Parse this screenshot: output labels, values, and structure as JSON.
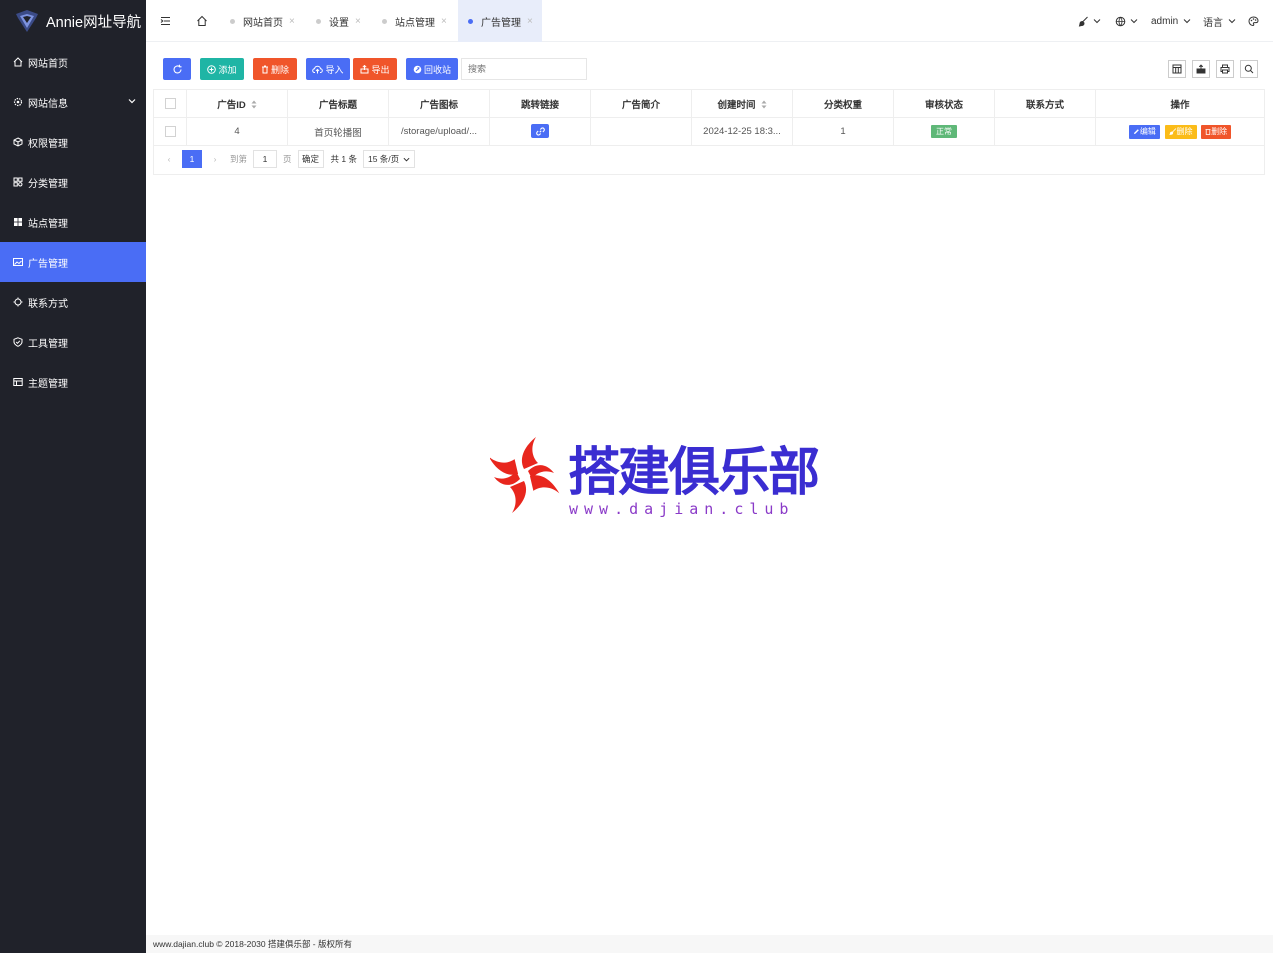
{
  "app": {
    "title": "Annie网址导航"
  },
  "sidebar": {
    "items": [
      {
        "label": "网站首页",
        "icon": "home-icon"
      },
      {
        "label": "网站信息",
        "icon": "gear-icon"
      },
      {
        "label": "权限管理",
        "icon": "cube-icon"
      },
      {
        "label": "分类管理",
        "icon": "category-icon"
      },
      {
        "label": "站点管理",
        "icon": "windows-icon"
      },
      {
        "label": "广告管理",
        "icon": "image-icon"
      },
      {
        "label": "联系方式",
        "icon": "cog-icon"
      },
      {
        "label": "工具管理",
        "icon": "shield-icon"
      },
      {
        "label": "主题管理",
        "icon": "table-icon"
      }
    ],
    "active_label": "广告管理"
  },
  "tabs": [
    {
      "label": "网站首页"
    },
    {
      "label": "设置"
    },
    {
      "label": "站点管理"
    },
    {
      "label": "广告管理"
    }
  ],
  "topbar": {
    "close_glyph": "×",
    "user": "admin",
    "language": "语言"
  },
  "toolbar": {
    "add": "添加",
    "delete": "删除",
    "import": "导入",
    "export": "导出",
    "recycle": "回收站",
    "search_placeholder": "搜索"
  },
  "table": {
    "headers": [
      "广告ID",
      "广告标题",
      "广告图标",
      "跳转链接",
      "广告简介",
      "创建时间",
      "分类权重",
      "审核状态",
      "联系方式",
      "操作"
    ],
    "rows": [
      {
        "id": "4",
        "title": "首页轮播图",
        "icon": "/storage/upload/...",
        "link_icon": "link-icon",
        "intro": "",
        "created": "2024-12-25 18:3...",
        "weight": "1",
        "status": "正常",
        "contact": "",
        "actions": {
          "edit": "编辑",
          "soft_delete": "删除",
          "delete": "删除"
        }
      }
    ]
  },
  "pager": {
    "current": "1",
    "goto_label": "到第",
    "goto_value": "1",
    "page_label": "页",
    "confirm": "确定",
    "total": "共 1 条",
    "page_size": "15 条/页"
  },
  "watermark": {
    "title": "搭建俱乐部",
    "subtitle": "www.dajian.club"
  },
  "footer": {
    "text": "www.dajian.club © 2018-2030 搭建俱乐部 - 版权所有"
  },
  "colors": {
    "accent": "#4a6df5",
    "sidebar_bg": "#20222a",
    "teal": "#1fb5a5",
    "red": "#f0552a",
    "yellow": "#fbbc18",
    "green": "#5fb878"
  }
}
